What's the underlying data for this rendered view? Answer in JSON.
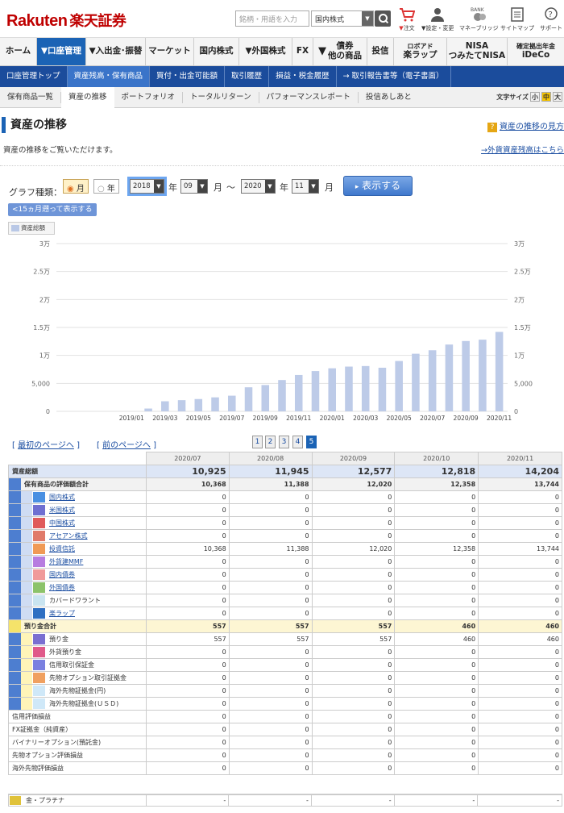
{
  "header": {
    "logo_en": "Rakuten",
    "logo_jp": "楽天証券",
    "search_placeholder": "銘柄・用語を入力",
    "market_select": "国内株式",
    "utils": [
      {
        "label": "注文",
        "icon": "cart-icon"
      },
      {
        "label": "設定・変更",
        "icon": "user-icon"
      },
      {
        "label": "マネーブリッジ",
        "icon": "bank-icon",
        "top": "BANK"
      },
      {
        "label": "サイトマップ",
        "icon": "sitemap-icon"
      },
      {
        "label": "サポート",
        "icon": "support-icon"
      }
    ]
  },
  "nav1": [
    {
      "label": "ホーム"
    },
    {
      "label": "▼口座管理",
      "active": true
    },
    {
      "label": "▼入出金･振替"
    },
    {
      "label": "マーケット"
    },
    {
      "label": "国内株式"
    },
    {
      "label": "▼外国株式"
    },
    {
      "label": "FX"
    },
    {
      "label": "債券\n他の商品",
      "arrow": "▼"
    },
    {
      "label": "投信"
    },
    {
      "label": "楽ラップ",
      "small": "ロボアド"
    },
    {
      "label": "NISA\nつみたてNISA"
    },
    {
      "label": "iDeCo",
      "small": "確定拠出年金"
    }
  ],
  "nav2": [
    "口座管理トップ",
    "資産残高・保有商品",
    "買付・出金可能額",
    "取引履歴",
    "損益・税金履歴",
    "→ 取引報告書等（電子書面）"
  ],
  "nav3": [
    "保有商品一覧",
    "資産の推移",
    "ポートフォリオ",
    "トータルリターン",
    "パフォーマンスレポート",
    "投信あしあと"
  ],
  "font_size": {
    "label": "文字サイズ",
    "small": "小",
    "mid": "中",
    "large": "大"
  },
  "page": {
    "title": "資産の推移",
    "help_link": "資産の推移の見方",
    "description": "資産の推移をご覧いただけます。",
    "fx_link": "→外貨資産残高はこちら"
  },
  "controls": {
    "graph_type_label": "グラフ種類：",
    "month": "月",
    "year": "年",
    "from_year": "2018",
    "from_month": "09",
    "to_year": "2020",
    "to_month": "11",
    "nen": "年",
    "tsuki": "月",
    "tilde": "〜",
    "show_button": "表示する",
    "back15": "<15ヵ月遡って表示する"
  },
  "legend": "資産総額",
  "chart_data": {
    "type": "bar",
    "series": [
      {
        "name": "資産総額",
        "values": [
          0,
          500,
          1800,
          2000,
          2200,
          2500,
          2800,
          4300,
          4700,
          5600,
          6500,
          7200,
          7700,
          8000,
          8100,
          7800,
          9000,
          10300,
          10925,
          11945,
          12577,
          12818,
          14204
        ]
      }
    ],
    "months": [
      "2018/09",
      "2018/10",
      "2018/11",
      "2018/12",
      "2019/01",
      "2019/02",
      "2019/03",
      "2019/04",
      "2019/05",
      "2019/06",
      "2019/07",
      "2019/08",
      "2019/09",
      "2019/10",
      "2019/11",
      "2019/12",
      "2020/01",
      "2020/02",
      "2020/03",
      "2020/04",
      "2020/05",
      "2020/06",
      "2020/07",
      "2020/08",
      "2020/09",
      "2020/10",
      "2020/11"
    ],
    "xticks": [
      "2019/01",
      "2019/03",
      "2019/05",
      "2019/07",
      "2019/09",
      "2019/11",
      "2020/01",
      "2020/03",
      "2020/05",
      "2020/07",
      "2020/09",
      "2020/11"
    ],
    "yticks": [
      "0",
      "5,000",
      "1万",
      "1.5万",
      "2万",
      "2.5万",
      "3万"
    ],
    "ylim": [
      0,
      30000
    ]
  },
  "pager": {
    "first": "最初のページへ",
    "prev": "前のページへ",
    "pages": [
      "1",
      "2",
      "3",
      "4",
      "5"
    ],
    "current": "5"
  },
  "table": {
    "months": [
      "2020/07",
      "2020/08",
      "2020/09",
      "2020/10",
      "2020/11"
    ],
    "rows": [
      {
        "label": "資産総額",
        "cls": "tot",
        "vals": [
          "10,925",
          "11,945",
          "12,577",
          "12,818",
          "14,204"
        ]
      },
      {
        "label": "保有商品の評価額合計",
        "cls": "sub",
        "indent": 1,
        "vals": [
          "10,368",
          "11,388",
          "12,020",
          "12,358",
          "13,744"
        ]
      },
      {
        "label": "国内株式",
        "sw": "#4a90e2",
        "link": true,
        "vals": [
          "0",
          "0",
          "0",
          "0",
          "0"
        ]
      },
      {
        "label": "米国株式",
        "sw": "#6f6fd1",
        "link": true,
        "vals": [
          "0",
          "0",
          "0",
          "0",
          "0"
        ]
      },
      {
        "label": "中国株式",
        "sw": "#e05a5a",
        "link": true,
        "vals": [
          "0",
          "0",
          "0",
          "0",
          "0"
        ]
      },
      {
        "label": "アセアン株式",
        "sw": "#e07a6a",
        "link": true,
        "vals": [
          "0",
          "0",
          "0",
          "0",
          "0"
        ]
      },
      {
        "label": "投資信託",
        "sw": "#f09a55",
        "link": true,
        "vals": [
          "10,368",
          "11,388",
          "12,020",
          "12,358",
          "13,744"
        ]
      },
      {
        "label": "外貨建MMF",
        "sw": "#b77de0",
        "link": true,
        "vals": [
          "0",
          "0",
          "0",
          "0",
          "0"
        ]
      },
      {
        "label": "国内債券",
        "sw": "#f09a9a",
        "link": true,
        "vals": [
          "0",
          "0",
          "0",
          "0",
          "0"
        ]
      },
      {
        "label": "外国債券",
        "sw": "#8cc36a",
        "link": true,
        "vals": [
          "0",
          "0",
          "0",
          "0",
          "0"
        ]
      },
      {
        "label": "カバードワラント",
        "sw": "#c9e4f0",
        "link": false,
        "vals": [
          "0",
          "0",
          "0",
          "0",
          "0"
        ]
      },
      {
        "label": "楽ラップ",
        "sw": "#2f6fc2",
        "link": true,
        "vals": [
          "0",
          "0",
          "0",
          "0",
          "0"
        ]
      },
      {
        "label": "預り金合計",
        "cls": "dep",
        "indent": 1,
        "vals": [
          "557",
          "557",
          "557",
          "460",
          "460"
        ]
      },
      {
        "label": "預り金",
        "sw": "#7a6fd1",
        "vals": [
          "557",
          "557",
          "557",
          "460",
          "460"
        ]
      },
      {
        "label": "外貨預り金",
        "sw": "#e05a8a",
        "vals": [
          "0",
          "0",
          "0",
          "0",
          "0"
        ]
      },
      {
        "label": "信用取引保証金",
        "sw": "#7a80e0",
        "vals": [
          "0",
          "0",
          "0",
          "0",
          "0"
        ]
      },
      {
        "label": "先物オプション取引証拠金",
        "sw": "#f0a060",
        "vals": [
          "0",
          "0",
          "0",
          "0",
          "0"
        ]
      },
      {
        "label": "海外先物証拠金(円)",
        "sw": "#cfe8f8",
        "vals": [
          "0",
          "0",
          "0",
          "0",
          "0"
        ]
      },
      {
        "label": "海外先物証拠金(ＵＳＤ)",
        "sw": "#cfe8f8",
        "vals": [
          "0",
          "0",
          "0",
          "0",
          "0"
        ]
      },
      {
        "label": "信用評価損益",
        "indent": 0,
        "vals": [
          "0",
          "0",
          "0",
          "0",
          "0"
        ]
      },
      {
        "label": "FX証拠金（純資産）",
        "indent": 0,
        "vals": [
          "0",
          "0",
          "0",
          "0",
          "0"
        ]
      },
      {
        "label": "バイナリーオプション(預託金)",
        "indent": 0,
        "vals": [
          "0",
          "0",
          "0",
          "0",
          "0"
        ]
      },
      {
        "label": "先物オプション評価損益",
        "indent": 0,
        "vals": [
          "0",
          "0",
          "0",
          "0",
          "0"
        ]
      },
      {
        "label": "海外先物評価損益",
        "indent": 0,
        "vals": [
          "0",
          "0",
          "0",
          "0",
          "0"
        ]
      }
    ]
  },
  "gold": {
    "label": "金・プラチナ",
    "vals": [
      "-",
      "-",
      "-",
      "-",
      "-"
    ]
  }
}
